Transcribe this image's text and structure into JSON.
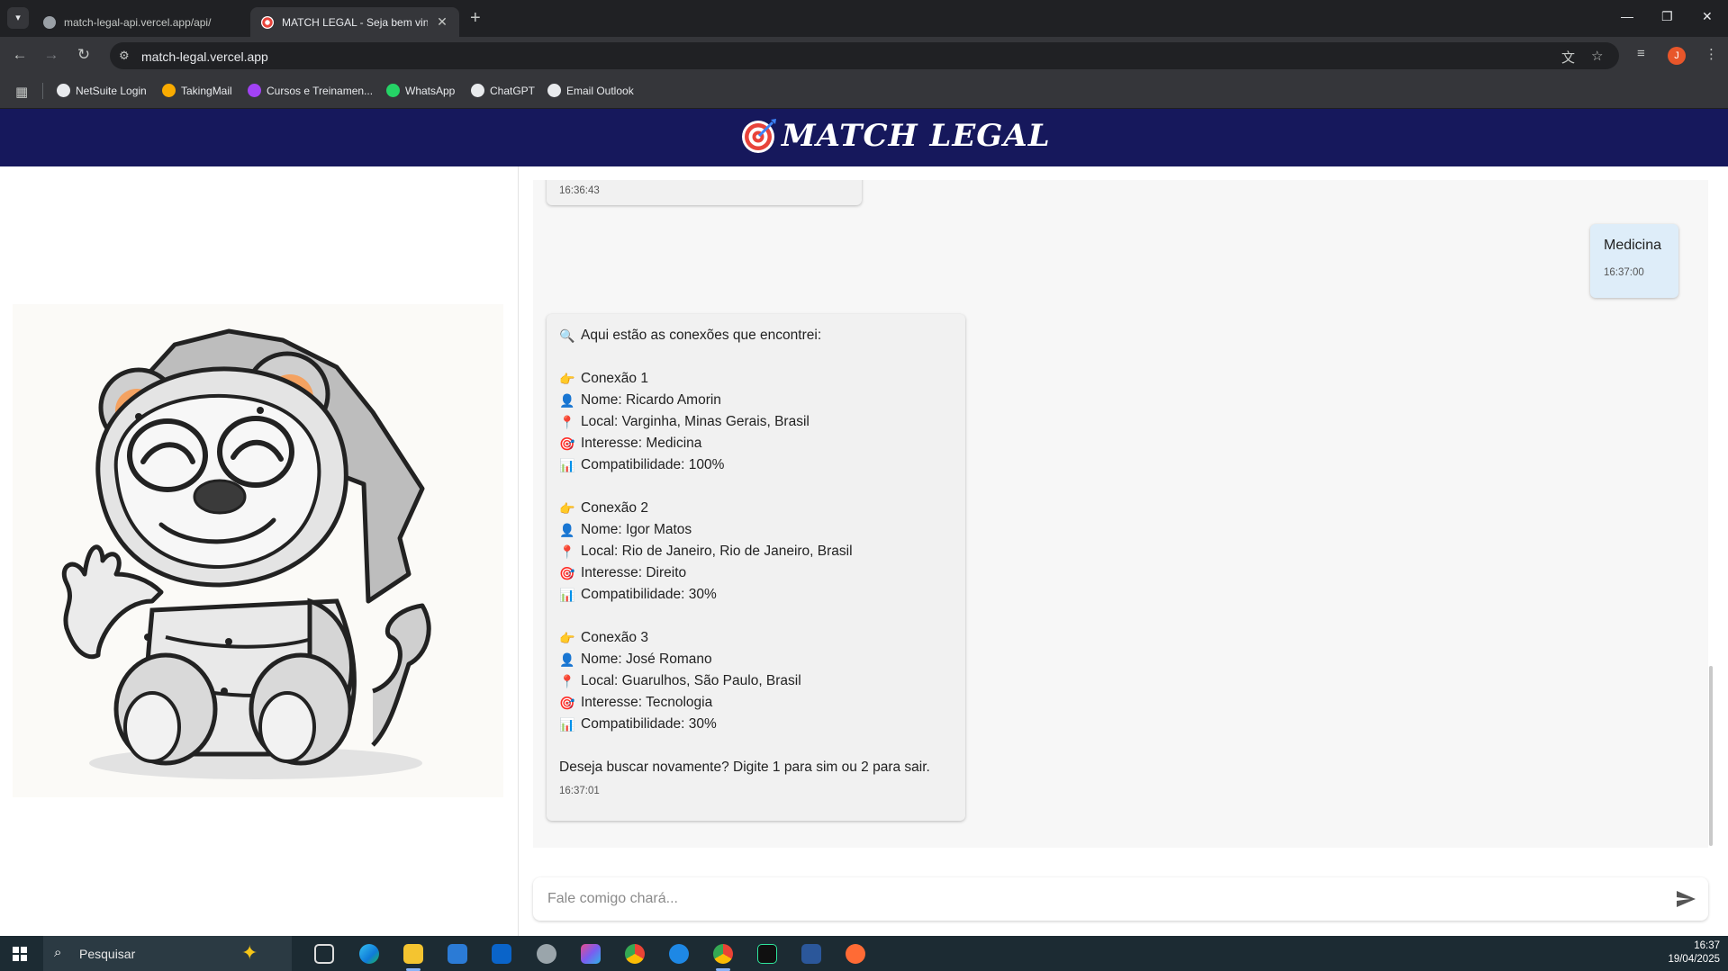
{
  "browser": {
    "tabs": [
      {
        "title": "match-legal-api.vercel.app/api/",
        "active": false
      },
      {
        "title": "MATCH LEGAL - Seja bem vindo",
        "active": true
      }
    ],
    "url": "match-legal.vercel.app",
    "profile_initial": "J",
    "bookmarks": [
      {
        "label": "NetSuite Login",
        "color": "#e8eaed"
      },
      {
        "label": "TakingMail",
        "color": "#f9ab00"
      },
      {
        "label": "Cursos e Treinamen...",
        "color": "#a142f4"
      },
      {
        "label": "WhatsApp",
        "color": "#25d366"
      },
      {
        "label": "ChatGPT",
        "color": "#e8eaed"
      },
      {
        "label": "Email Outlook",
        "color": "#e8eaed"
      }
    ]
  },
  "app": {
    "brand": "MATCH LEGAL",
    "colors": {
      "header": "#16185c",
      "user_bubble": "#deedf9",
      "bot_bubble": "#f1f1f1"
    }
  },
  "chat": {
    "messages": [
      {
        "from": "bot",
        "time": "16:36:43"
      },
      {
        "from": "user",
        "text": "Medicina",
        "time": "16:37:00"
      },
      {
        "from": "bot",
        "intro": "Aqui estão as conexões que encontrei:",
        "connections": [
          {
            "title": "Conexão 1",
            "nome": "Nome: Ricardo Amorin",
            "local": "Local: Varginha, Minas Gerais, Brasil",
            "interesse": "Interesse: Medicina",
            "compat": "Compatibilidade: 100%"
          },
          {
            "title": "Conexão 2",
            "nome": "Nome: Igor Matos",
            "local": "Local: Rio de Janeiro, Rio de Janeiro, Brasil",
            "interesse": "Interesse: Direito",
            "compat": "Compatibilidade: 30%"
          },
          {
            "title": "Conexão 3",
            "nome": "Nome: José Romano",
            "local": "Local: Guarulhos, São Paulo, Brasil",
            "interesse": "Interesse: Tecnologia",
            "compat": "Compatibilidade: 30%"
          }
        ],
        "outro": "Deseja buscar novamente? Digite 1 para sim ou 2 para sair.",
        "time": "16:37:01"
      }
    ],
    "input_placeholder": "Fale comigo chará..."
  },
  "icons": {
    "search": "🔍",
    "point": "👉",
    "person": "👤",
    "pin": "📍",
    "target": "🎯",
    "chart": "📊"
  },
  "taskbar": {
    "search_label": "Pesquisar",
    "time": "16:37",
    "date": "19/04/2025"
  }
}
